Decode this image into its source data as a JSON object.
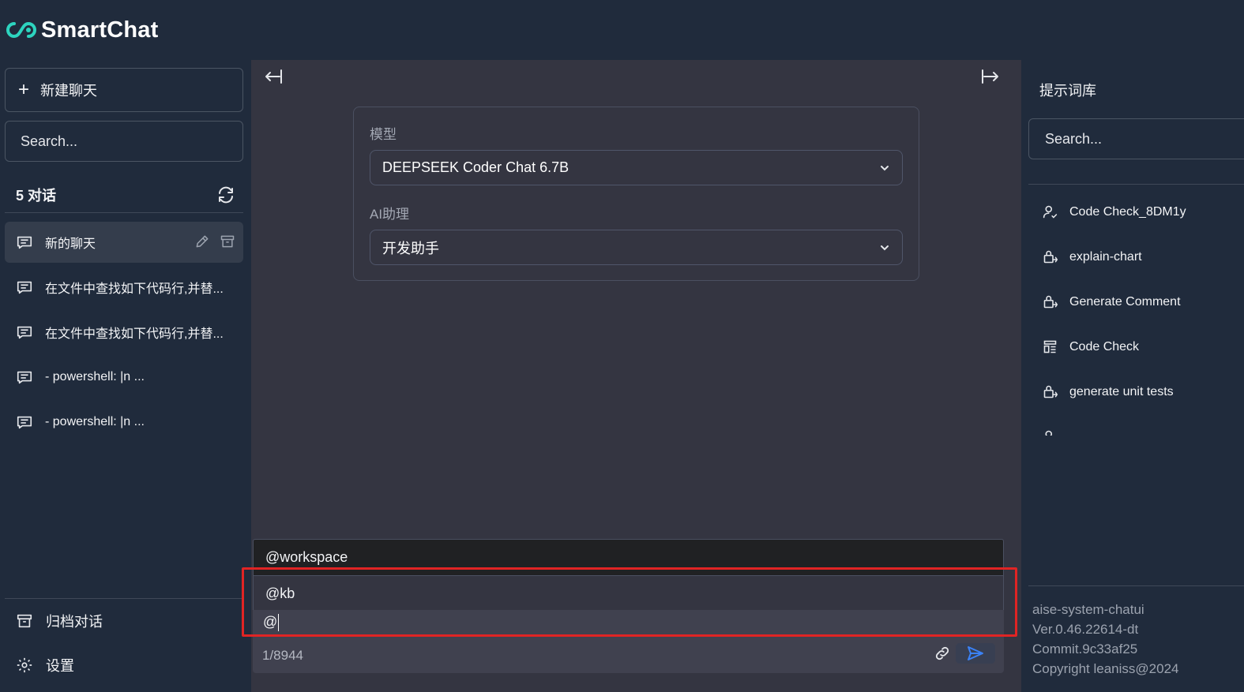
{
  "app": {
    "brand": "SmartChat",
    "colors": {
      "accent": "#2dd4bf",
      "sidebar_bg": "#202b3c",
      "main_bg": "#343541",
      "highlight": "#e02424",
      "send": "#3b82f6"
    }
  },
  "sidebar": {
    "new_chat_label": "新建聊天",
    "search_placeholder": "Search...",
    "conversation_count": "5 对话",
    "conversations": [
      {
        "label": "新的聊天",
        "active": true
      },
      {
        "label": "在文件中查找如下代码行,并替...",
        "active": false
      },
      {
        "label": "在文件中查找如下代码行,并替...",
        "active": false
      },
      {
        "label": "- powershell: |n ...",
        "active": false
      },
      {
        "label": "- powershell: |n ...",
        "active": false
      }
    ],
    "archive_label": "归档对话",
    "settings_label": "设置"
  },
  "main": {
    "model_label": "模型",
    "model_value": "DEEPSEEK Coder Chat 6.7B",
    "assistant_label": "AI助理",
    "assistant_value": "开发助手",
    "suggestions": [
      "@workspace",
      "@kb"
    ],
    "selected_suggestion": 1,
    "input_value": "@",
    "char_count": "1/8944"
  },
  "rightbar": {
    "title": "提示词库",
    "search_placeholder": "Search...",
    "prompts": [
      {
        "label": "Code Check_8DM1y",
        "icon": "user-share-icon"
      },
      {
        "label": "explain-chart",
        "icon": "lock-share-icon"
      },
      {
        "label": "Generate Comment",
        "icon": "lock-share-icon"
      },
      {
        "label": "Code Check",
        "icon": "layout-list-icon"
      },
      {
        "label": "generate unit tests",
        "icon": "lock-share-icon"
      },
      {
        "label": "...",
        "icon": "user-share-icon"
      }
    ],
    "footer": [
      "aise-system-chatui",
      "Ver.0.46.22614-dt",
      "Commit.9c33af25",
      "Copyright leaniss@2024"
    ]
  }
}
